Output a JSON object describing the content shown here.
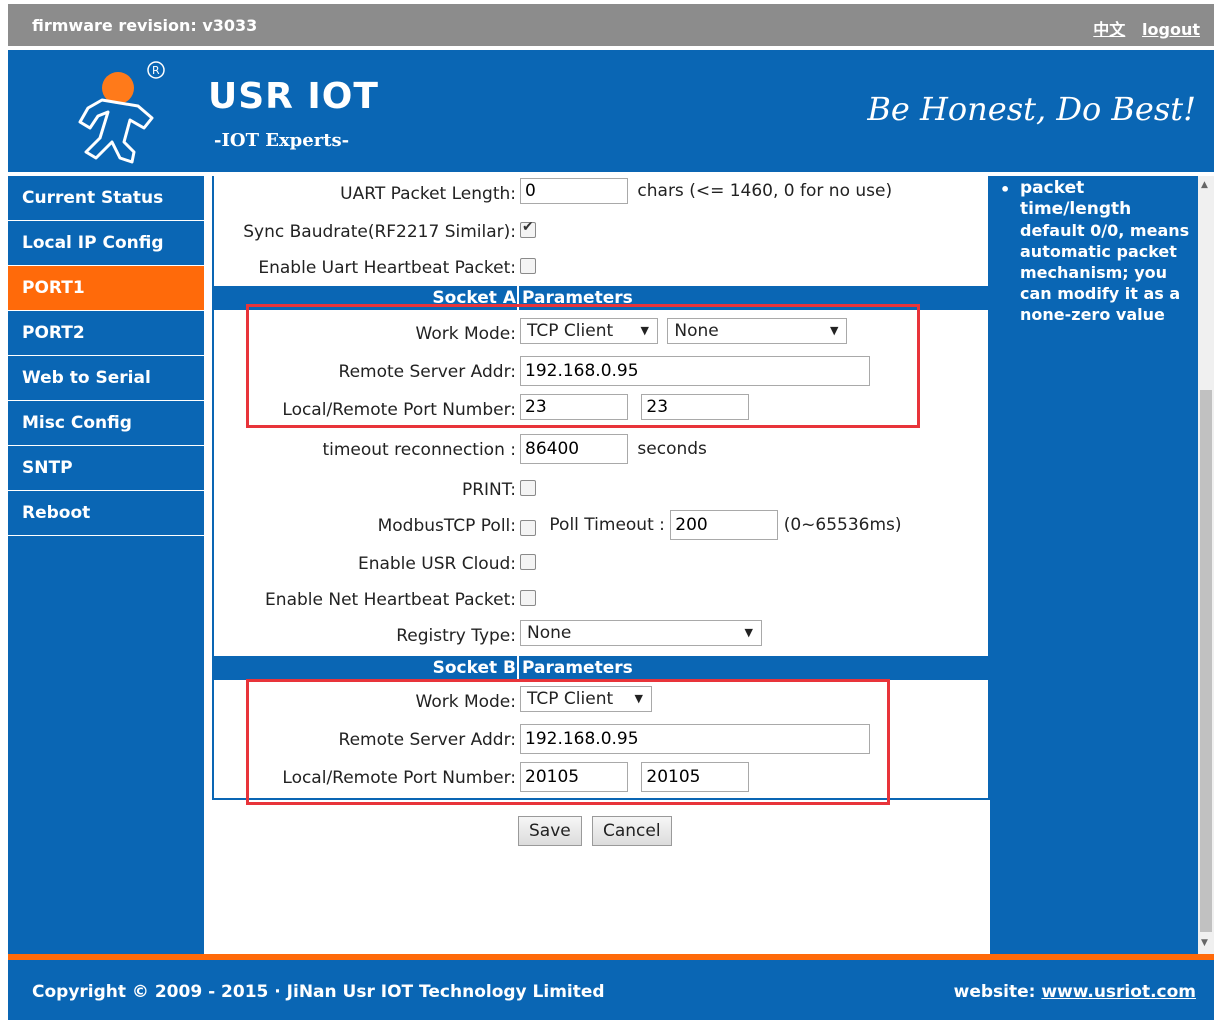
{
  "topbar": {
    "firmware": "firmware revision: v3033",
    "lang": "中文",
    "logout": "logout"
  },
  "header": {
    "brand": "USR IOT",
    "brand_sub": "-IOT Experts-",
    "slogan": "Be Honest, Do Best!"
  },
  "sidebar": {
    "items": [
      {
        "label": "Current Status",
        "active": false
      },
      {
        "label": "Local IP Config",
        "active": false
      },
      {
        "label": "PORT1",
        "active": true
      },
      {
        "label": "PORT2",
        "active": false
      },
      {
        "label": "Web to Serial",
        "active": false
      },
      {
        "label": "Misc Config",
        "active": false
      },
      {
        "label": "SNTP",
        "active": false
      },
      {
        "label": "Reboot",
        "active": false
      }
    ]
  },
  "form": {
    "uart_packet_length": {
      "label": "UART Packet Length:",
      "value": "0",
      "suffix": "chars (<= 1460, 0 for no use)"
    },
    "sync_baudrate": {
      "label": "Sync Baudrate(RF2217 Similar):",
      "checked": true
    },
    "uart_heartbeat": {
      "label": "Enable Uart Heartbeat Packet:",
      "checked": false
    },
    "socket_a": {
      "title_left": "Socket A",
      "title_right": "Parameters",
      "work_mode_label": "Work Mode:",
      "work_mode": "TCP Client",
      "work_mode2": "None",
      "remote_addr_label": "Remote Server Addr:",
      "remote_addr": "192.168.0.95",
      "port_label": "Local/Remote Port Number:",
      "local_port": "23",
      "remote_port": "23"
    },
    "timeout": {
      "label": "timeout reconnection :",
      "value": "86400",
      "suffix": "seconds"
    },
    "print": {
      "label": "PRINT:",
      "checked": false
    },
    "modbus": {
      "label": "ModbusTCP Poll:",
      "checked": false,
      "poll_timeout_label": "Poll Timeout :",
      "poll_timeout": "200",
      "suffix": "(0~65536ms)"
    },
    "usr_cloud": {
      "label": "Enable USR Cloud:",
      "checked": false
    },
    "net_heartbeat": {
      "label": "Enable Net Heartbeat Packet:",
      "checked": false
    },
    "registry": {
      "label": "Registry Type:",
      "value": "None"
    },
    "socket_b": {
      "title_left": "Socket B",
      "title_right": "Parameters",
      "work_mode_label": "Work Mode:",
      "work_mode": "TCP Client",
      "remote_addr_label": "Remote Server Addr:",
      "remote_addr": "192.168.0.95",
      "port_label": "Local/Remote Port Number:",
      "local_port": "20105",
      "remote_port": "20105"
    },
    "save": "Save",
    "cancel": "Cancel"
  },
  "help": {
    "title": "packet time/length",
    "body": "default 0/0, means automatic packet mechanism; you can modify it as a none-zero value"
  },
  "footer": {
    "copyright": "Copyright © 2009 - 2015 · JiNan Usr IOT Technology Limited",
    "website_label": "website:",
    "website": "www.usriot.com"
  },
  "colors": {
    "brand_blue": "#0a66b4",
    "accent_orange": "#ff6a0a",
    "highlight_red": "#e8343a"
  }
}
